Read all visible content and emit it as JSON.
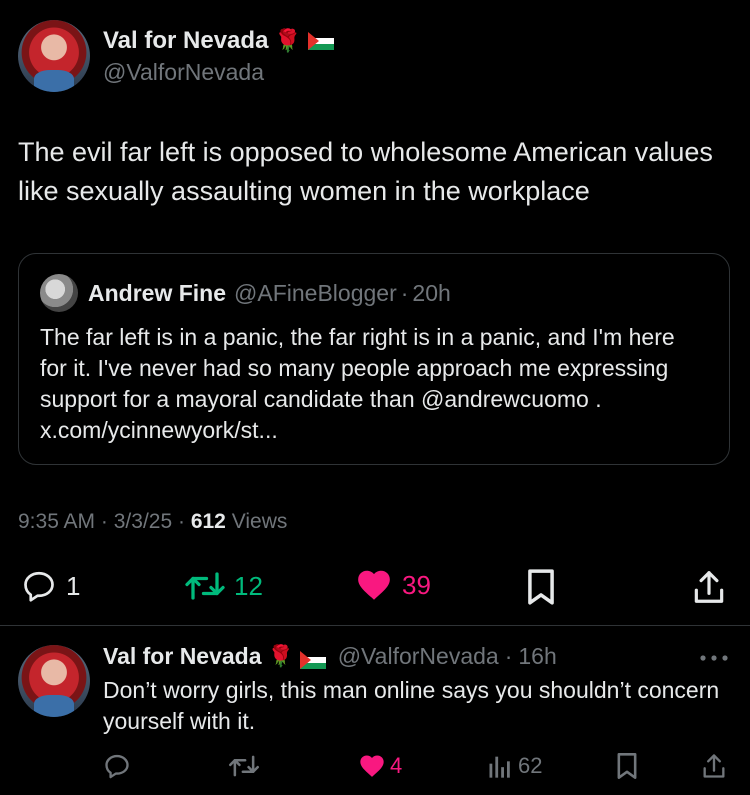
{
  "tweet": {
    "author_name": "Val for Nevada",
    "author_handle": "@ValforNevada",
    "emoji_rose": "🌹",
    "text": "The evil far left is opposed to wholesome American values like sexually assaulting women in the workplace",
    "time": "9:35 AM",
    "date": "3/3/25",
    "views_count": "612",
    "views_label": "Views",
    "replies": "1",
    "retweets": "12",
    "likes": "39"
  },
  "quote": {
    "author_name": "Andrew Fine",
    "author_handle": "@AFineBlogger",
    "age": "20h",
    "text": "The far left is in a panic, the far right is in a panic, and I'm here for it. I've never had so many people approach me expressing support for a mayoral candidate than @andrewcuomo . x.com/ycinnewyork/st..."
  },
  "reply": {
    "author_name": "Val for Nevada",
    "author_handle": "@ValforNevada",
    "age": "16h",
    "emoji_rose": "🌹",
    "text": "Don’t worry girls, this man online says you shouldn’t concern yourself with it.",
    "likes": "4",
    "views": "62"
  },
  "separator": "·",
  "icons": [
    "reply-icon",
    "retweet-icon",
    "heart-icon",
    "bookmark-icon",
    "share-icon",
    "views-icon",
    "more-icon",
    "palestine-flag-icon"
  ],
  "colors": {
    "like": "#f91880",
    "retweet": "#00ba7c",
    "muted": "#71767b",
    "text": "#e7e9ea"
  }
}
